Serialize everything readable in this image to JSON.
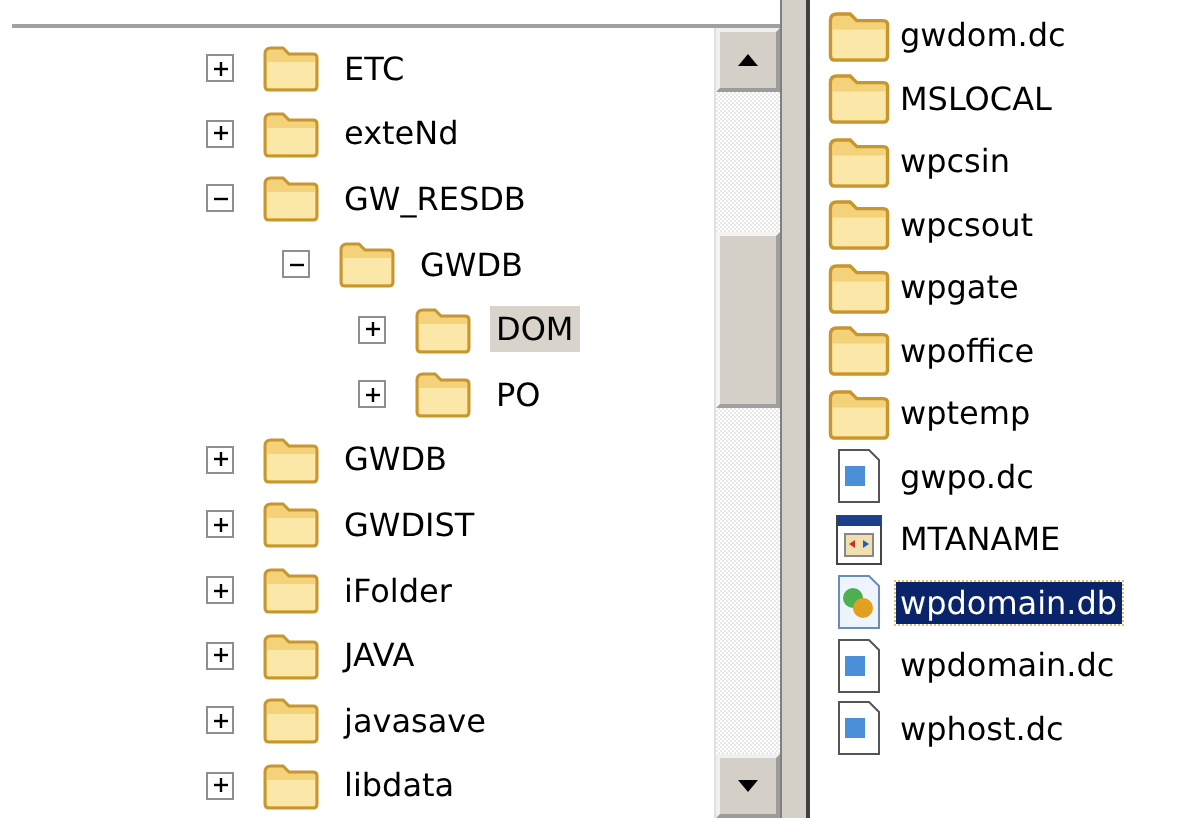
{
  "folder_tree": [
    {
      "label": "ETC",
      "expanded": false,
      "selected": false
    },
    {
      "label": "exteNd",
      "expanded": false,
      "selected": false
    },
    {
      "label": "GW_RESDB",
      "expanded": true,
      "selected": false,
      "children": [
        {
          "label": "GWDB",
          "expanded": true,
          "selected": false,
          "children": [
            {
              "label": "DOM",
              "expanded": false,
              "selected": true
            },
            {
              "label": "PO",
              "expanded": false,
              "selected": false
            }
          ]
        }
      ]
    },
    {
      "label": "GWDB",
      "expanded": false,
      "selected": false
    },
    {
      "label": "GWDIST",
      "expanded": false,
      "selected": false
    },
    {
      "label": "iFolder",
      "expanded": false,
      "selected": false
    },
    {
      "label": "JAVA",
      "expanded": false,
      "selected": false
    },
    {
      "label": "javasave",
      "expanded": false,
      "selected": false
    },
    {
      "label": "libdata",
      "expanded": false,
      "selected": false
    }
  ],
  "file_list": [
    {
      "name": "gwdom.dc",
      "kind": "folder",
      "selected": false
    },
    {
      "name": "MSLOCAL",
      "kind": "folder",
      "selected": false
    },
    {
      "name": "wpcsin",
      "kind": "folder",
      "selected": false
    },
    {
      "name": "wpcsout",
      "kind": "folder",
      "selected": false
    },
    {
      "name": "wpgate",
      "kind": "folder",
      "selected": false
    },
    {
      "name": "wpoffice",
      "kind": "folder",
      "selected": false
    },
    {
      "name": "wptemp",
      "kind": "folder",
      "selected": false
    },
    {
      "name": "gwpo.dc",
      "kind": "document",
      "selected": false
    },
    {
      "name": "MTANAME",
      "kind": "application",
      "selected": false
    },
    {
      "name": "wpdomain.db",
      "kind": "database",
      "selected": true
    },
    {
      "name": "wpdomain.dc",
      "kind": "document",
      "selected": false
    },
    {
      "name": "wphost.dc",
      "kind": "document",
      "selected": false
    }
  ]
}
